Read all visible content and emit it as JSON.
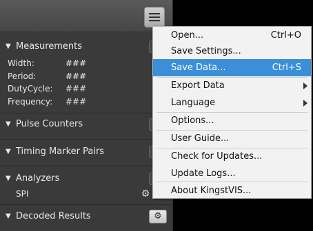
{
  "panel": {
    "sections": {
      "measurements": "Measurements",
      "pulse_counters": "Pulse Counters",
      "timing_marker_pairs": "Timing Marker Pairs",
      "analyzers": "Analyzers",
      "decoded_results": "Decoded Results"
    },
    "measurements": [
      {
        "label": "Width:",
        "value": "###"
      },
      {
        "label": "Period:",
        "value": "###"
      },
      {
        "label": "DutyCycle:",
        "value": "###"
      },
      {
        "label": "Frequency:",
        "value": "###"
      }
    ],
    "analyzers": [
      {
        "name": "SPI"
      }
    ]
  },
  "menu": {
    "items": [
      {
        "label": "Open...",
        "shortcut": "Ctrl+O"
      },
      {
        "label": "Save Settings...",
        "shortcut": ""
      },
      {
        "label": "Save Data...",
        "shortcut": "Ctrl+S",
        "highlighted": true
      },
      {
        "label": "Export Data",
        "submenu": true
      },
      {
        "label": "Language",
        "submenu": true
      },
      {
        "label": "Options..."
      },
      {
        "label": "User Guide..."
      },
      {
        "label": "Check for Updates..."
      },
      {
        "label": "Update Logs..."
      },
      {
        "label": "About KingstVIS..."
      }
    ]
  },
  "colors": {
    "highlight": "#3a8fd8",
    "panel_bg": "#3a3a3a"
  },
  "icons": {
    "menu": "hamburger-icon",
    "settings": "gear-icon",
    "collapse": "triangle-down-icon",
    "submenu": "chevron-right-icon"
  }
}
